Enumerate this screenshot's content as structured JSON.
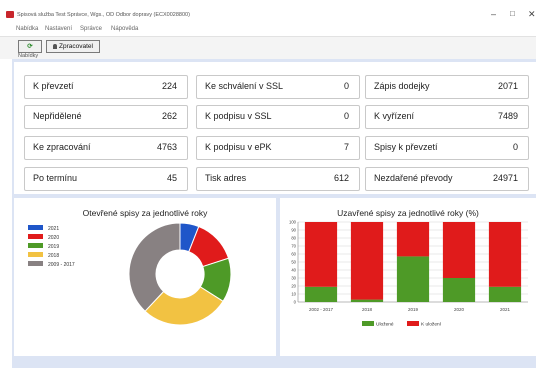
{
  "window": {
    "title": "Spisová služba Test Správce, Wgs., OD Odbor dopravy (ECX0028800)"
  },
  "menu": [
    "Nabídka",
    "Nastavení",
    "Správce",
    "Nápověda"
  ],
  "toolbar": {
    "refresh_label": "⟳",
    "processor_label": "Zpracovatel"
  },
  "section_label": "Nabídky",
  "tiles": [
    {
      "label": "K převzetí",
      "value": "224"
    },
    {
      "label": "Ke schválení v SSL",
      "value": "0"
    },
    {
      "label": "Zápis dodejky",
      "value": "2071"
    },
    {
      "label": "Nepřidělené",
      "value": "262"
    },
    {
      "label": "K podpisu v SSL",
      "value": "0"
    },
    {
      "label": "K vyřízení",
      "value": "7489"
    },
    {
      "label": "Ke zpracování",
      "value": "4763"
    },
    {
      "label": "K podpisu v ePK",
      "value": "7"
    },
    {
      "label": "Spisy k převzetí",
      "value": "0"
    },
    {
      "label": "Po termínu",
      "value": "45"
    },
    {
      "label": "Tisk adres",
      "value": "612"
    },
    {
      "label": "Nezdařené převody",
      "value": "24971"
    }
  ],
  "chart_data": [
    {
      "type": "pie",
      "title": "Otevřené spisy za jednotlivé roky",
      "legend_position": "top-left",
      "categories": [
        "2021",
        "2020",
        "2019",
        "2018",
        "2009 - 2017"
      ],
      "values": [
        6,
        14,
        14,
        28,
        38
      ],
      "colors": [
        "#1f56c9",
        "#e01b1b",
        "#4e9a27",
        "#f2c242",
        "#888182"
      ]
    },
    {
      "type": "bar",
      "stacked": true,
      "title": "Uzavřené spisy za jednotlivé roky (%)",
      "categories": [
        "2002 - 2017",
        "2018",
        "2019",
        "2020",
        "2021"
      ],
      "ylim": [
        0,
        100
      ],
      "yticks": [
        0,
        10,
        20,
        30,
        40,
        50,
        60,
        70,
        80,
        90,
        100
      ],
      "grid": true,
      "legend_position": "bottom",
      "series": [
        {
          "name": "Uložené",
          "color": "#4e9a27",
          "values": [
            19,
            3,
            57,
            30,
            19
          ]
        },
        {
          "name": "K uložení",
          "color": "#e01b1b",
          "values": [
            81,
            97,
            43,
            70,
            81
          ]
        }
      ]
    }
  ]
}
